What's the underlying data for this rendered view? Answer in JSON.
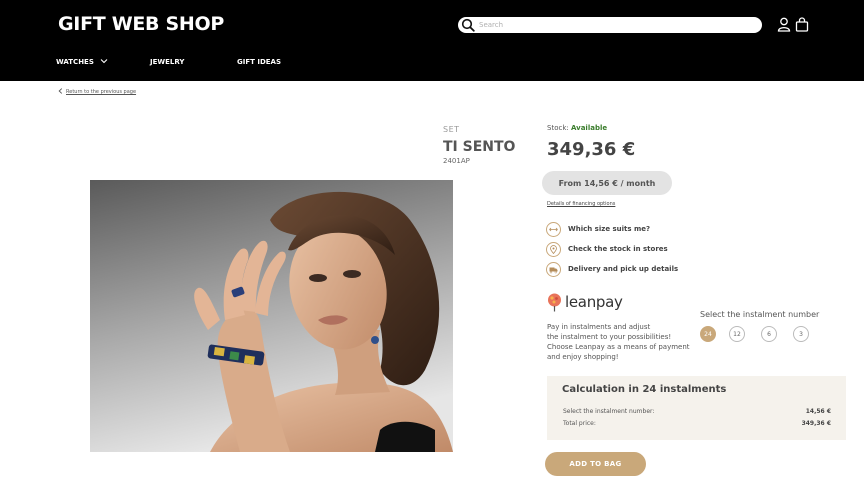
{
  "header": {
    "logo": "GIFT WEB SHOP",
    "search_placeholder": "Search",
    "nav": [
      {
        "label": "WATCHES",
        "has_dropdown": true
      },
      {
        "label": "JEWELRY"
      },
      {
        "label": "GIFT IDEAS"
      }
    ],
    "icons": [
      "search-icon",
      "user-icon",
      "shopping-bag-icon"
    ]
  },
  "breadcrumb": {
    "back_label": "Return to the previous page"
  },
  "product": {
    "category": "SET",
    "name": "TI SENTO",
    "code": "2401AP",
    "image_icon": "product-photo-model-wearing-bracelet-and-ring"
  },
  "buy_box": {
    "stock_label": "Stock:",
    "stock_value": "Available",
    "price": "349,36 €",
    "finance_button": "From 14,56 € / month",
    "finance_link": "Details of financing options",
    "features": [
      {
        "icon": "ruler-icon",
        "label": "Which size suits me?"
      },
      {
        "icon": "location-pin-icon",
        "label": "Check the stock in stores"
      },
      {
        "icon": "delivery-truck-icon",
        "label": "Delivery and pick up details"
      }
    ]
  },
  "leanpay": {
    "logo_text": "leanpay",
    "description_lines": [
      "Pay in instalments and adjust",
      "the instalment to your possibilities!",
      "Choose Leanpay as a means of payment",
      "and enjoy shopping!"
    ],
    "instalment_title": "Select the instalment number",
    "options": [
      "24",
      "12",
      "6",
      "3"
    ],
    "selected": "24"
  },
  "calculation": {
    "title": "Calculation in 24 instalments",
    "rows": [
      {
        "label": "Select the instalment number:",
        "value": "14,56 €"
      },
      {
        "label": "Total price:",
        "value": "349,36 €"
      }
    ]
  },
  "add_to_bag": "ADD TO BAG",
  "colors": {
    "header_bg": "#000000",
    "accent_gold": "#c9a87a",
    "available_green": "#3a7d2c",
    "finance_button_bg": "#e3e3e3",
    "calc_box_bg": "#f5f2ec"
  }
}
